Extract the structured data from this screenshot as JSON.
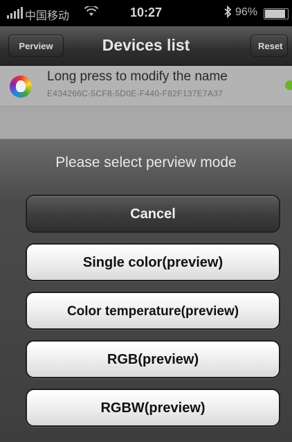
{
  "status_bar": {
    "carrier": "中国移动",
    "time": "10:27",
    "battery": "96%",
    "battery_level": 0.96
  },
  "navbar": {
    "left_button": "Perview",
    "title": "Devices list",
    "right_button": "Reset"
  },
  "device": {
    "name": "Long press to modify the name",
    "id": "E434266C-5CF8-5D0E-F440-F82F137E7A37",
    "status_color": "#6ab42a"
  },
  "sheet": {
    "title": "Please select perview mode",
    "cancel": "Cancel",
    "options": [
      "Single color(preview)",
      "Color temperature(preview)",
      "RGB(preview)",
      "RGBW(preview)"
    ]
  }
}
